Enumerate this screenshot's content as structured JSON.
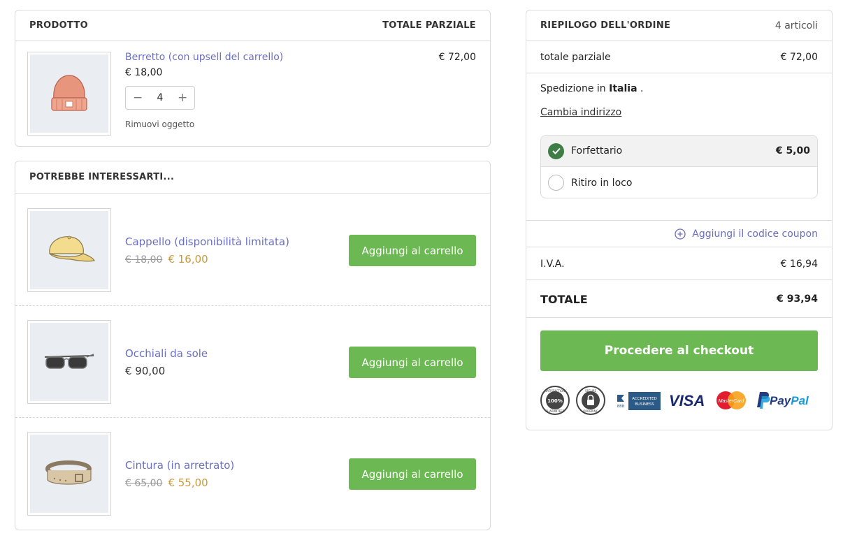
{
  "cart": {
    "header_product": "PRODOTTO",
    "header_subtotal": "TOTALE PARZIALE",
    "item": {
      "name": "Berretto (con upsell del carrello)",
      "unit_price": "€ 18,00",
      "quantity": "4",
      "line_total": "€ 72,00",
      "remove_label": "Rimuovi oggetto",
      "image_icon": "beanie-icon"
    }
  },
  "upsell": {
    "title": "POTREBBE INTERESSARTI...",
    "button_label": "Aggiungi al carrello",
    "items": [
      {
        "name": "Cappello (disponibilità limitata)",
        "old_price": "€ 18,00",
        "price": "€ 16,00",
        "image_icon": "cap-icon"
      },
      {
        "name": "Occhiali da sole",
        "price": "€ 90,00",
        "image_icon": "sunglasses-icon"
      },
      {
        "name": "Cintura (in arretrato)",
        "old_price": "€ 65,00",
        "price": "€ 55,00",
        "image_icon": "belt-icon"
      }
    ]
  },
  "summary": {
    "title": "RIEPILOGO DELL'ORDINE",
    "item_count": "4 articoli",
    "subtotal_label": "totale parziale",
    "subtotal_value": "€ 72,00",
    "shipping_prefix": "Spedizione in",
    "shipping_country": "Italia",
    "shipping_suffix": ".",
    "change_address": "Cambia indirizzo",
    "shipping_options": [
      {
        "label": "Forfettario",
        "price": "€ 5,00",
        "selected": true
      },
      {
        "label": "Ritiro in loco",
        "price": "",
        "selected": false
      }
    ],
    "coupon_label": "Aggiungi il codice coupon",
    "vat_label": "I.V.A.",
    "vat_value": "€ 16,94",
    "total_label": "TOTALE",
    "total_value": "€ 93,94",
    "checkout_label": "Procedere al checkout"
  },
  "trust_badges": {
    "satisfaction_top": "SATISFACTION",
    "satisfaction_mid": "100%",
    "satisfaction_bottom": "GUARANTEED",
    "secure_top": "SECURE",
    "secure_bottom": "ORDERING",
    "bbb": "BBB",
    "accredited_1": "ACCREDITED",
    "accredited_2": "BUSINESS",
    "visa": "VISA",
    "mastercard": "MasterCard",
    "paypal_pay": "Pay",
    "paypal_pal": "Pal"
  },
  "colors": {
    "accent_green": "#6cb953",
    "link_purple": "#6a6fc0",
    "sale_gold": "#c99a3d",
    "check_green": "#3e7d45"
  }
}
